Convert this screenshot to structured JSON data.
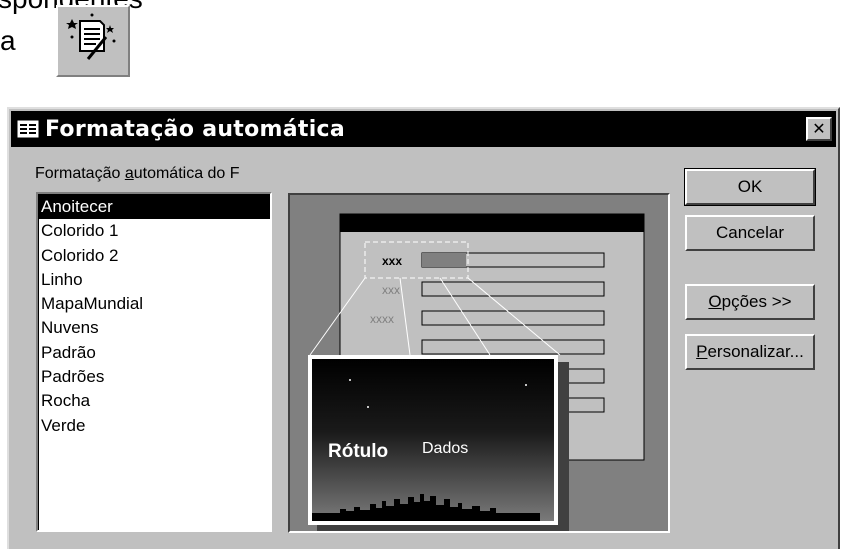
{
  "document": {
    "line1": "spondentes",
    "line2": "a"
  },
  "toolbar": {
    "autoformat_icon": "autoformat-wand-icon"
  },
  "dialog": {
    "title": "Formatação automática",
    "title_icon": "form-icon",
    "close_label": "✕",
    "list_label_pre": "Formatação ",
    "list_label_key": "a",
    "list_label_post": "utomática do F",
    "list_items": [
      "Anoitecer",
      "Colorido 1",
      "Colorido 2",
      "Linho",
      "MapaMundial",
      "Nuvens",
      "Padrão",
      "Padrões",
      "Rocha",
      "Verde"
    ],
    "selected_item": "Anoitecer",
    "buttons": {
      "ok": "OK",
      "cancel": "Cancelar",
      "options_key": "O",
      "options_post": "pções >>",
      "customize_key": "P",
      "customize_post": "ersonalizar..."
    },
    "preview": {
      "field_labels": [
        "xxx",
        "xxx",
        "xxxx"
      ],
      "label_text": "Rótulo",
      "data_text": "Dados"
    }
  }
}
